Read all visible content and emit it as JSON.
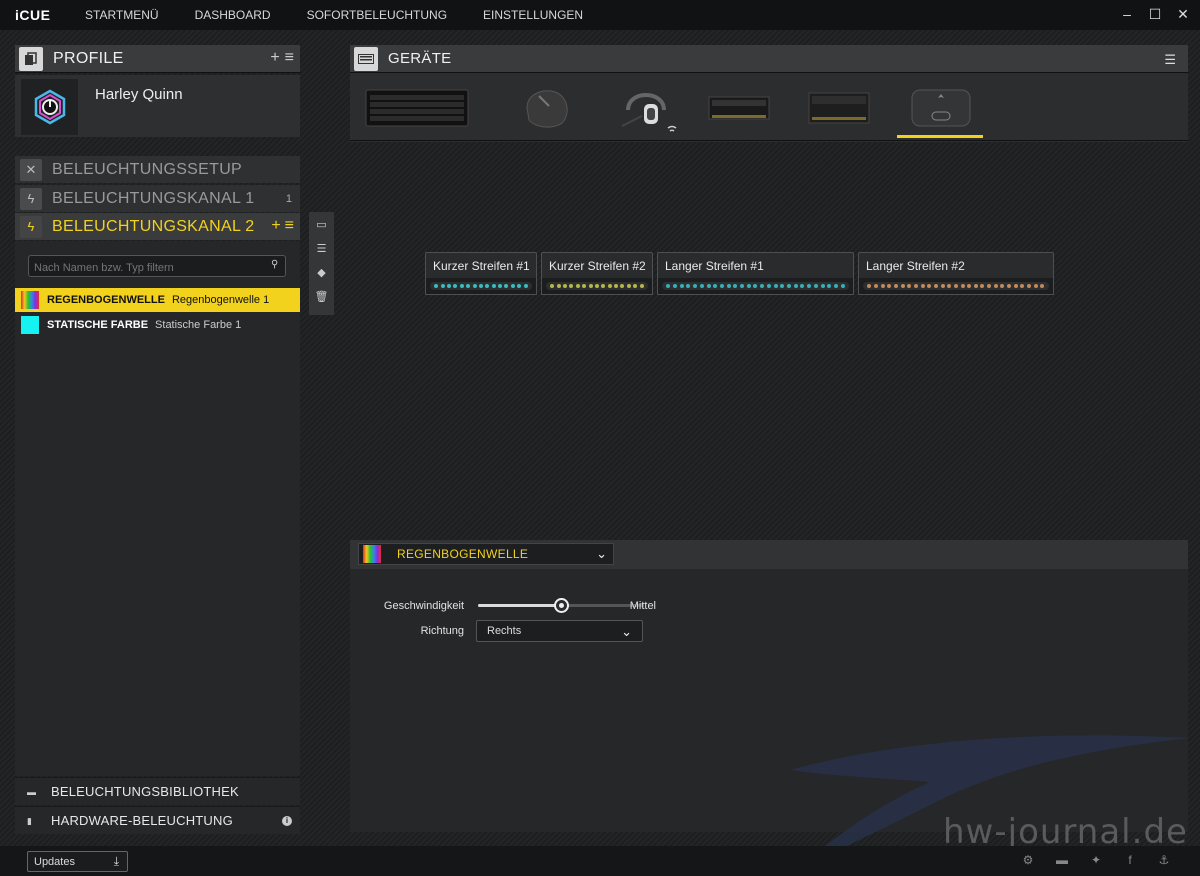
{
  "app": {
    "logo": "iCUE"
  },
  "nav": [
    {
      "label": "STARTMENÜ"
    },
    {
      "label": "DASHBOARD"
    },
    {
      "label": "SOFORTBELEUCHTUNG"
    },
    {
      "label": "EINSTELLUNGEN"
    }
  ],
  "profiles": {
    "title": "PROFILE",
    "add": "+",
    "menu": "≡",
    "current_profile": "Harley Quinn"
  },
  "lighting": {
    "setup_label": "BELEUCHTUNGSSETUP",
    "channel1_label": "BELEUCHTUNGSKANAL 1",
    "channel1_count": "1",
    "channel2_label": "BELEUCHTUNGSKANAL 2",
    "filter_placeholder": "Nach Namen bzw. Typ filtern",
    "effects": [
      {
        "type": "REGENBOGENWELLE",
        "name": "Regenbogenwelle 1",
        "selected": true
      },
      {
        "type": "STATISCHE FARBE",
        "name": "Statische Farbe 1",
        "selected": false,
        "color": "#16f2f2"
      }
    ],
    "library_label": "BELEUCHTUNGSBIBLIOTHEK",
    "hardware_label": "HARDWARE-BELEUCHTUNG"
  },
  "devices": {
    "title": "GERÄTE",
    "items": [
      {
        "icon": "keyboard-icon"
      },
      {
        "icon": "mouse-icon"
      },
      {
        "icon": "headset-icon"
      },
      {
        "icon": "ram-icon"
      },
      {
        "icon": "ram-rgb-icon"
      },
      {
        "icon": "lighting-node-icon",
        "selected": true
      }
    ]
  },
  "strips": [
    {
      "label": "Kurzer Streifen #1",
      "led_color": "#38bcc0",
      "leds": 15
    },
    {
      "label": "Kurzer Streifen #2",
      "led_color": "#b6b64a",
      "leds": 15
    },
    {
      "label": "Langer Streifen #1",
      "led_color": "#36b0b8",
      "leds": 27
    },
    {
      "label": "Langer Streifen #2",
      "led_color": "#c08a5a",
      "leds": 27
    }
  ],
  "effect_panel": {
    "selected_effect": "REGENBOGENWELLE",
    "speed_label": "Geschwindigkeit",
    "speed_value_text": "Mittel",
    "speed_fraction": 0.5,
    "direction_label": "Richtung",
    "direction_value": "Rechts"
  },
  "watermark": "hw-journal.de",
  "statusbar": {
    "updates_label": "Updates"
  },
  "colors": {
    "accent": "#f2d21d",
    "panel": "#262729",
    "header": "#3a3b3d"
  }
}
